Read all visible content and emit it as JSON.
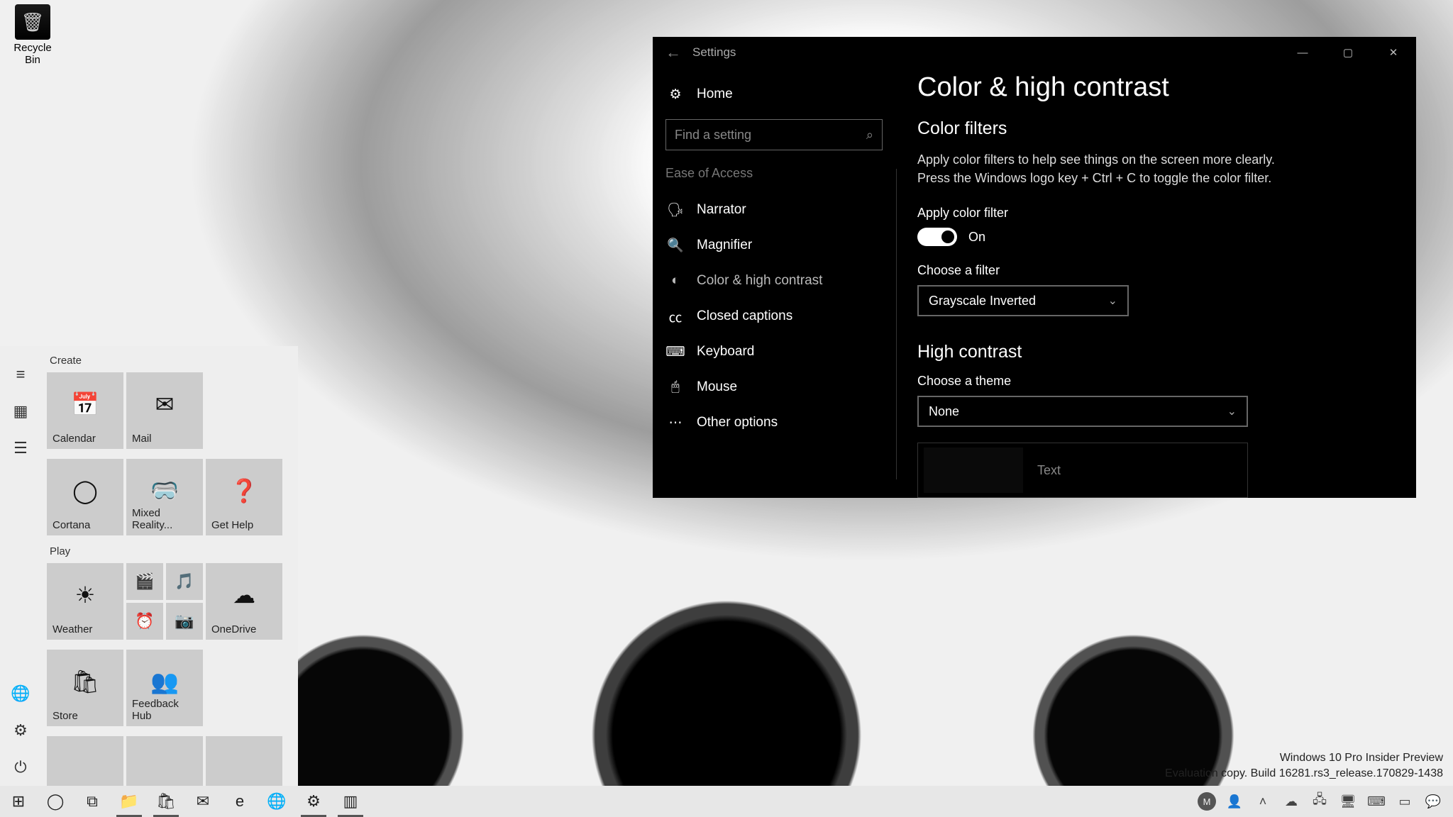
{
  "desktop": {
    "recycle_bin": "Recycle Bin"
  },
  "settings": {
    "window_title": "Settings",
    "page_title": "Color & high contrast",
    "sidebar": {
      "home": "Home",
      "search_placeholder": "Find a setting",
      "section": "Ease of Access",
      "items": [
        {
          "label": "Narrator",
          "icon": "narrator-icon"
        },
        {
          "label": "Magnifier",
          "icon": "magnifier-icon"
        },
        {
          "label": "Color & high contrast",
          "icon": "contrast-icon",
          "active": true
        },
        {
          "label": "Closed captions",
          "icon": "captions-icon"
        },
        {
          "label": "Keyboard",
          "icon": "keyboard-icon"
        },
        {
          "label": "Mouse",
          "icon": "mouse-icon"
        },
        {
          "label": "Other options",
          "icon": "options-icon"
        }
      ]
    },
    "color_filters": {
      "heading": "Color filters",
      "description": "Apply color filters to help see things on the screen more clearly. Press the Windows logo key + Ctrl + C to toggle the color filter.",
      "toggle_label": "Apply color filter",
      "toggle_state_text": "On",
      "toggle_on": true,
      "choose_label": "Choose a filter",
      "selected_filter": "Grayscale Inverted"
    },
    "high_contrast": {
      "heading": "High contrast",
      "choose_label": "Choose a theme",
      "selected_theme": "None",
      "preview_text": "Text"
    }
  },
  "start": {
    "groups": [
      {
        "label": "Create",
        "tiles": [
          {
            "size": "med",
            "label": "Calendar",
            "icon": "calendar-icon"
          },
          {
            "size": "med",
            "label": "Mail",
            "icon": "mail-icon"
          },
          {
            "size": "med",
            "label": "Cortana",
            "icon": "cortana-icon"
          },
          {
            "size": "med",
            "label": "Mixed Reality...",
            "icon": "mixed-reality-icon"
          },
          {
            "size": "med",
            "label": "Get Help",
            "icon": "help-icon"
          }
        ]
      },
      {
        "label": "Play",
        "tiles": [
          {
            "size": "med",
            "label": "Weather",
            "icon": "weather-icon"
          },
          {
            "size": "smallgrid",
            "small": [
              {
                "icon": "movies-icon"
              },
              {
                "icon": "groove-icon"
              },
              {
                "icon": "alarm-icon"
              },
              {
                "icon": "camera-icon"
              }
            ]
          },
          {
            "size": "med",
            "label": "OneDrive",
            "icon": "onedrive-icon"
          },
          {
            "size": "med",
            "label": "Store",
            "icon": "store-icon"
          },
          {
            "size": "med",
            "label": "Feedback Hub",
            "icon": "feedback-icon"
          }
        ]
      }
    ]
  },
  "watermark": {
    "line1": "Windows 10 Pro Insider Preview",
    "line2": "Evaluation copy. Build 16281.rs3_release.170829-1438"
  },
  "taskbar": {
    "left": [
      {
        "name": "start-button",
        "glyph": "⊞",
        "running": false
      },
      {
        "name": "cortana-button",
        "glyph": "◯",
        "running": false
      },
      {
        "name": "task-view-button",
        "glyph": "⧉",
        "running": false
      },
      {
        "name": "file-explorer",
        "glyph": "📁",
        "running": true
      },
      {
        "name": "store-taskbar",
        "glyph": "🛍",
        "running": true
      },
      {
        "name": "mail-taskbar",
        "glyph": "✉",
        "running": false
      },
      {
        "name": "edge-taskbar",
        "glyph": "e",
        "running": false
      },
      {
        "name": "globe-taskbar",
        "glyph": "🌐",
        "running": false
      },
      {
        "name": "settings-taskbar",
        "glyph": "⚙",
        "running": true
      },
      {
        "name": "notepad-taskbar",
        "glyph": "▥",
        "running": true
      }
    ],
    "tray": [
      {
        "name": "people-tray",
        "glyph": "👤"
      },
      {
        "name": "overflow-tray",
        "glyph": "˄"
      },
      {
        "name": "onedrive-tray",
        "glyph": "☁"
      },
      {
        "name": "network-tray",
        "glyph": "🖧"
      },
      {
        "name": "display-tray",
        "glyph": "🖥"
      },
      {
        "name": "keyboard-tray",
        "glyph": "⌨"
      },
      {
        "name": "input-tray",
        "glyph": "▭"
      },
      {
        "name": "action-center",
        "glyph": "💬"
      }
    ],
    "avatar_initial": "M"
  }
}
